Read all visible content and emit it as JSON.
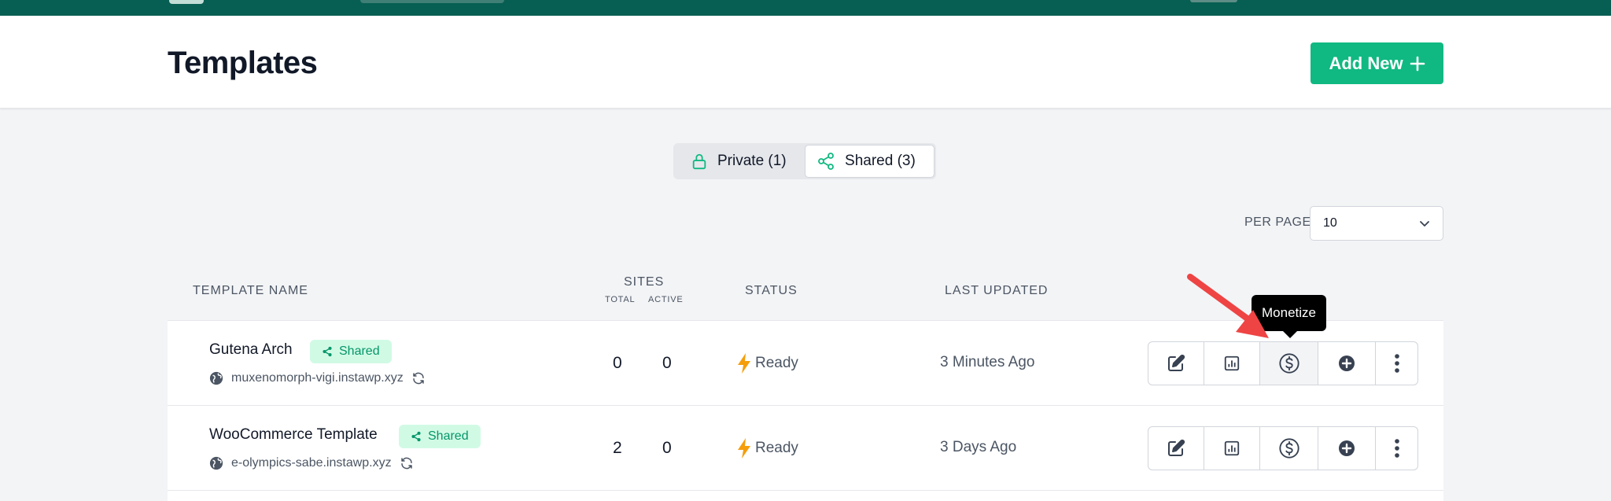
{
  "header": {
    "title": "Templates",
    "add_button": "Add New"
  },
  "filter_tabs": [
    {
      "label": "Private (1)",
      "icon": "lock-icon",
      "active": false
    },
    {
      "label": "Shared (3)",
      "icon": "share-icon",
      "active": true
    }
  ],
  "per_page": {
    "label": "PER PAGE",
    "value": "10"
  },
  "table": {
    "headers": {
      "name": "TEMPLATE NAME",
      "sites": "SITES",
      "total": "TOTAL",
      "active": "ACTIVE",
      "status": "STATUS",
      "updated": "LAST UPDATED"
    },
    "rows": [
      {
        "name": "Gutena Arch",
        "badge": "Shared",
        "domain": "muxenomorph-vigi.instawp.xyz",
        "total": "0",
        "active": "0",
        "status": "Ready",
        "updated": "3 Minutes Ago"
      },
      {
        "name": "WooCommerce Template",
        "badge": "Shared",
        "domain": "e-olympics-sabe.instawp.xyz",
        "total": "2",
        "active": "0",
        "status": "Ready",
        "updated": "3 Days Ago"
      }
    ]
  },
  "tooltip": "Monetize",
  "colors": {
    "brand": "#065f52",
    "accent": "#10b981",
    "badge_bg": "#d1fae5",
    "badge_text": "#059669",
    "status_icon": "#f59e0b",
    "arrow": "#ef4444"
  }
}
